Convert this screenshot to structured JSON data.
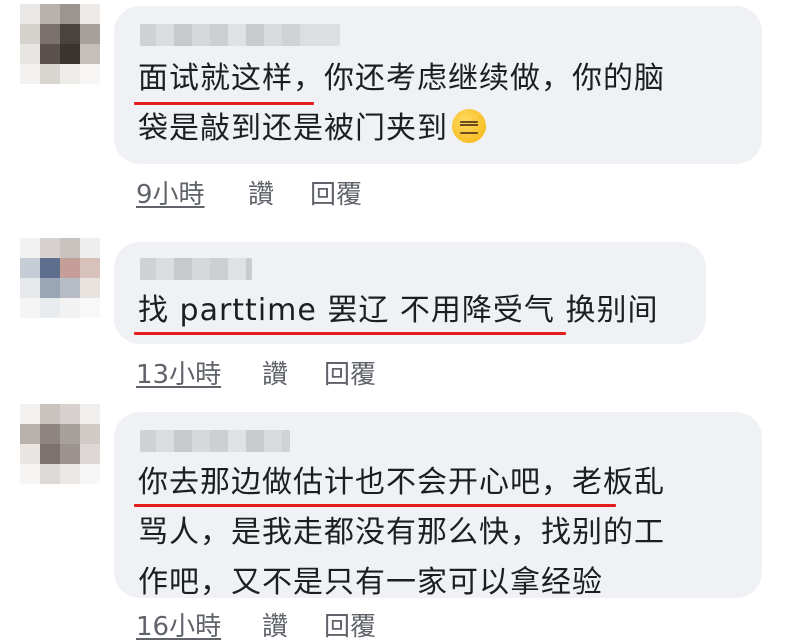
{
  "comments": [
    {
      "text_lines": [
        "面试就这样，你还考虑继续做，你的脑",
        "袋是敲到还是被门夹到"
      ],
      "emoji": "expressionless-face-icon",
      "time": "9小時",
      "like_label": "讚",
      "reply_label": "回覆"
    },
    {
      "text_lines": [
        "找 parttime 罢辽 不用降受气 换别间"
      ],
      "time": "13小時",
      "like_label": "讚",
      "reply_label": "回覆"
    },
    {
      "text_lines": [
        "你去那边做估计也不会开心吧，老板乱",
        "骂人，是我走都没有那么快，找别的工",
        "作吧，又不是只有一家可以拿经验"
      ],
      "time": "16小時",
      "like_label": "讚",
      "reply_label": "回覆"
    }
  ],
  "colors": {
    "bubble": "#eff1f4",
    "underline": "#e41b1b",
    "meta_text": "#60646a"
  }
}
